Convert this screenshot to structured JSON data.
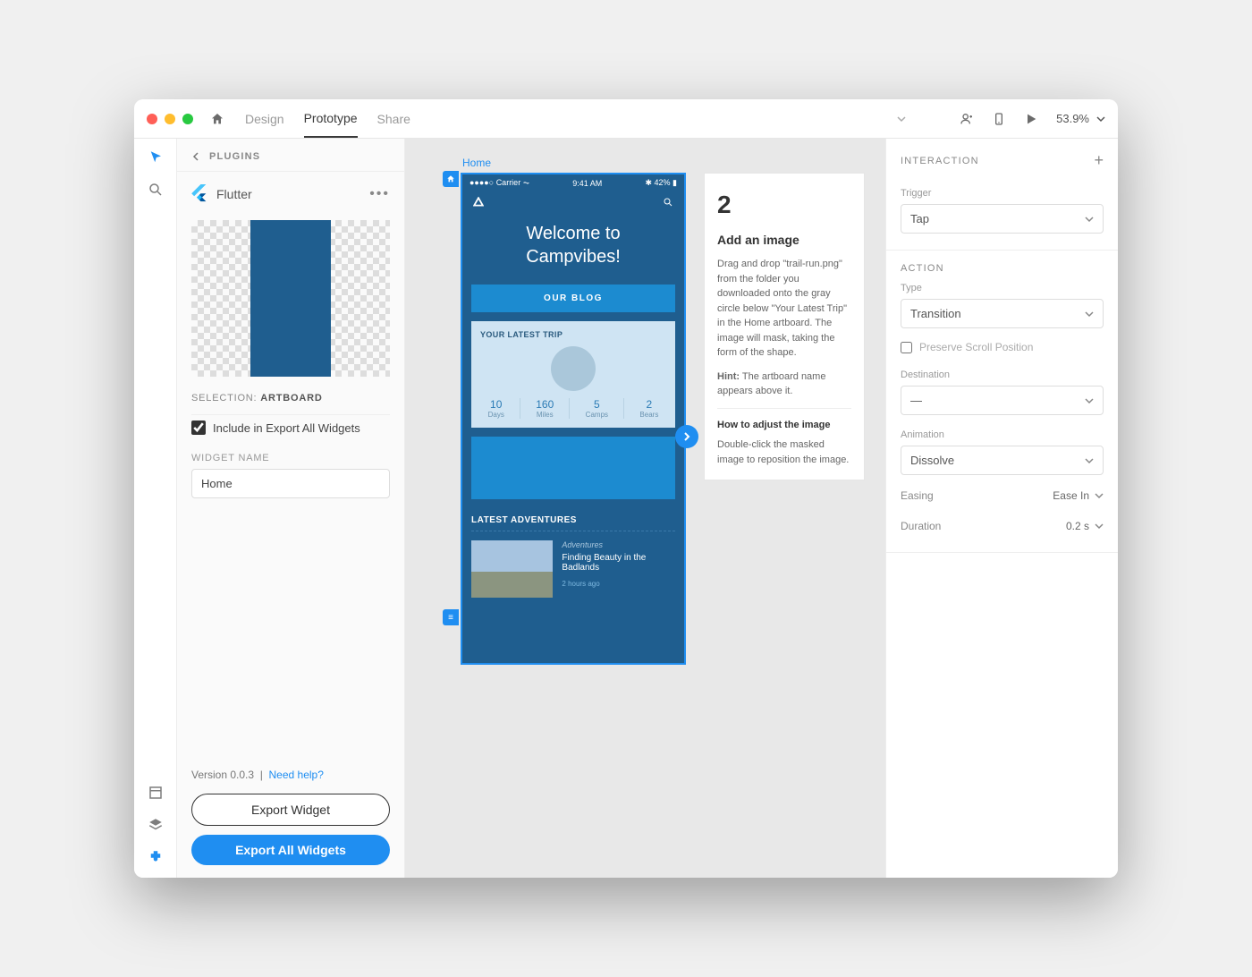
{
  "titlebar": {
    "tabs": {
      "design": "Design",
      "prototype": "Prototype",
      "share": "Share"
    },
    "zoom": "53.9%"
  },
  "leftPanel": {
    "headerTitle": "PLUGINS",
    "pluginName": "Flutter",
    "selectionLabel": "SELECTION:",
    "selectionValue": "ARTBOARD",
    "includeExportLabel": "Include in Export All Widgets",
    "widgetNameLabel": "WIDGET NAME",
    "widgetNameValue": "Home",
    "version": "Version 0.0.3",
    "helpLink": "Need help?",
    "exportWidget": "Export Widget",
    "exportAll": "Export All Widgets"
  },
  "canvas": {
    "artboardLabel": "Home",
    "statusCarrier": "Carrier",
    "statusTime": "9:41 AM",
    "statusBattery": "42%",
    "welcome1": "Welcome to",
    "welcome2": "Campvibes!",
    "blogButton": "OUR BLOG",
    "tripTitle": "YOUR LATEST TRIP",
    "stats": [
      {
        "n": "10",
        "l": "Days"
      },
      {
        "n": "160",
        "l": "Miles"
      },
      {
        "n": "5",
        "l": "Camps"
      },
      {
        "n": "2",
        "l": "Bears"
      }
    ],
    "adventuresTitle": "LATEST ADVENTURES",
    "advCategory": "Adventures",
    "advHeadline": "Finding Beauty in the Badlands",
    "advTime": "2 hours ago"
  },
  "tutorial": {
    "num": "2",
    "heading": "Add an image",
    "body1": "Drag and drop \"trail-run.png\" from the folder you downloaded onto the gray circle below \"Your Latest Trip\" in the Home artboard. The image will mask, taking the form of the shape.",
    "hintLabel": "Hint:",
    "hintBody": "The artboard name appears above it.",
    "howTitle": "How to adjust the image",
    "body2": "Double-click the masked image to reposition the image."
  },
  "rightPanel": {
    "sectionInteraction": "INTERACTION",
    "triggerLabel": "Trigger",
    "triggerValue": "Tap",
    "sectionAction": "ACTION",
    "typeLabel": "Type",
    "typeValue": "Transition",
    "preserveScroll": "Preserve Scroll Position",
    "destinationLabel": "Destination",
    "destinationValue": "—",
    "animationLabel": "Animation",
    "animationValue": "Dissolve",
    "easingLabel": "Easing",
    "easingValue": "Ease In",
    "durationLabel": "Duration",
    "durationValue": "0.2 s"
  }
}
